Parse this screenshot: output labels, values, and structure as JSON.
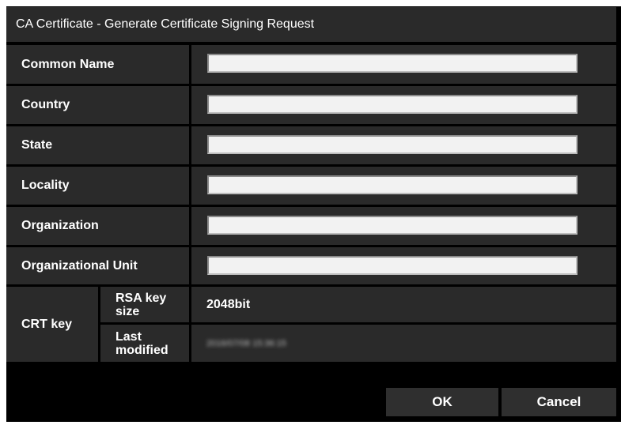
{
  "dialog": {
    "title": "CA Certificate - Generate Certificate Signing Request"
  },
  "fields": [
    {
      "label": "Common Name",
      "value": ""
    },
    {
      "label": "Country",
      "value": ""
    },
    {
      "label": "State",
      "value": ""
    },
    {
      "label": "Locality",
      "value": ""
    },
    {
      "label": "Organization",
      "value": ""
    },
    {
      "label": "Organizational Unit",
      "value": ""
    }
  ],
  "crt_key": {
    "label": "CRT key",
    "rsa_key_size_label": "RSA key size",
    "rsa_key_size_value": "2048bit",
    "last_modified_label": "Last modified",
    "last_modified_value": "2016/07/08 15:36:15"
  },
  "buttons": {
    "ok": "OK",
    "cancel": "Cancel"
  }
}
